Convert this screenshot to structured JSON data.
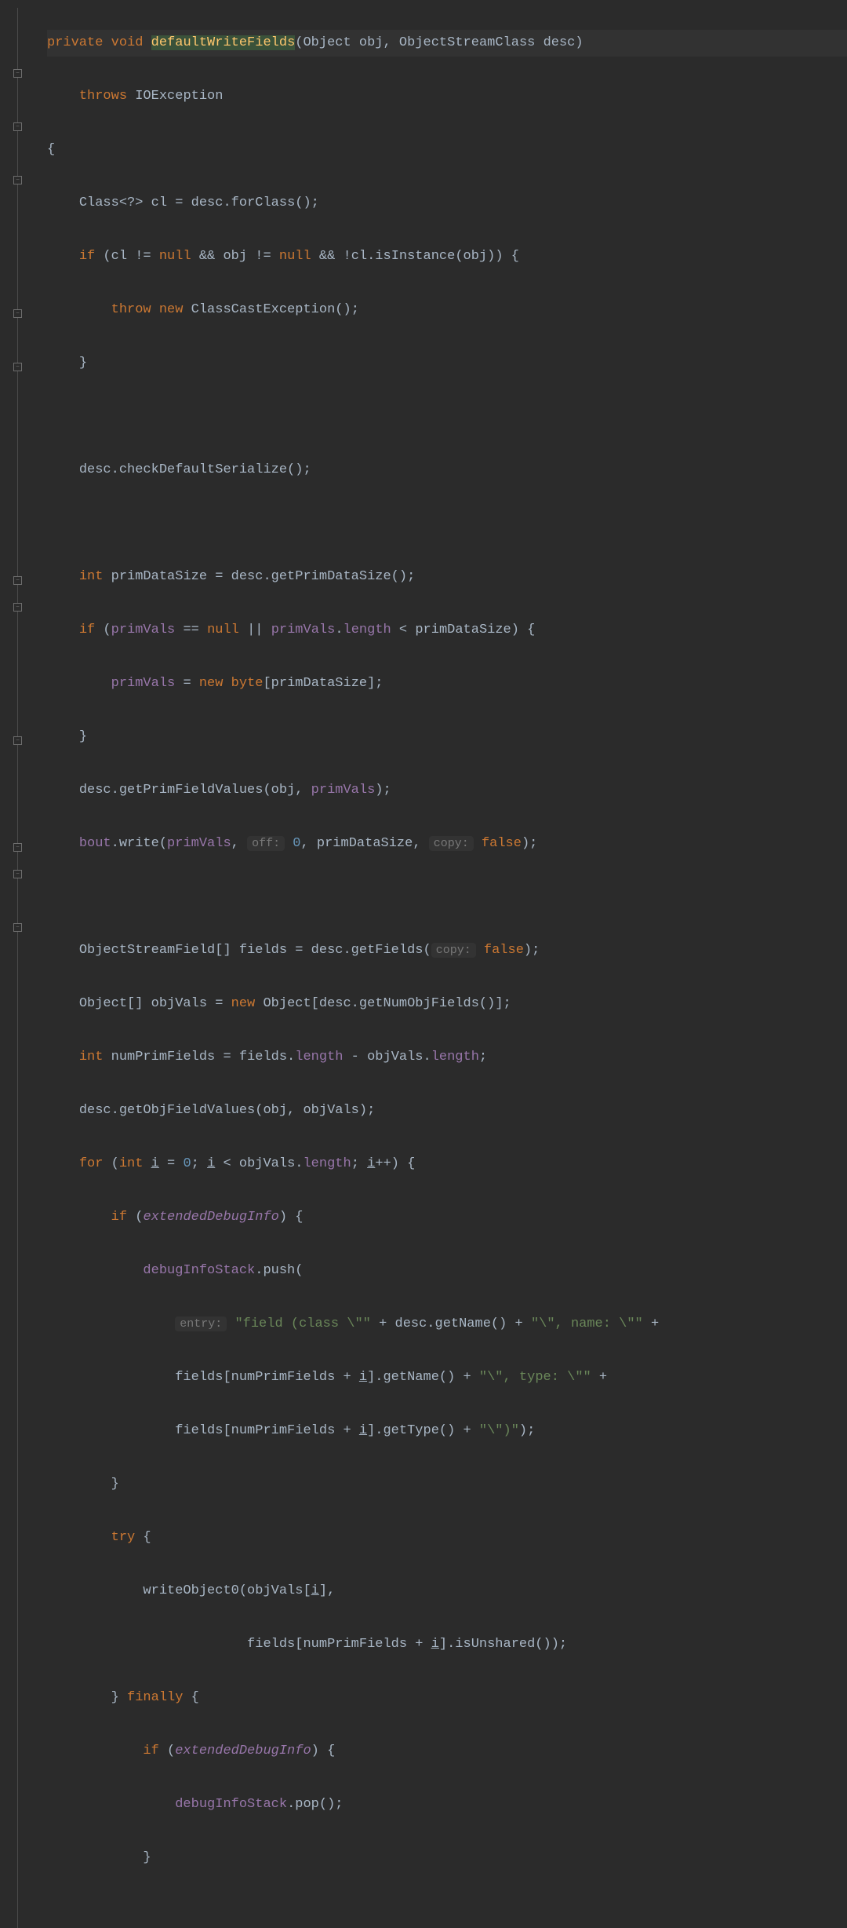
{
  "theme": {
    "background": "#2b2b2b",
    "foreground": "#a9b7c6",
    "keyword": "#cc7832",
    "methodDecl": "#ffc66d",
    "field": "#9876aa",
    "number": "#6897bb",
    "string": "#6a8759",
    "hint": "#787878"
  },
  "code": {
    "l1": {
      "kw1": "private",
      "kw2": "void",
      "method": "defaultWriteFields",
      "p1t": "Object",
      "p1n": "obj",
      "p2t": "ObjectStreamClass",
      "p2n": "desc"
    },
    "l2": {
      "kw": "throws",
      "ex": "IOException"
    },
    "l3": "{",
    "l4": {
      "t": "Class<?> ",
      "v": "cl",
      "eq": " = desc.forClass();"
    },
    "l5": {
      "kw": "if",
      "open": " (cl != ",
      "n1": "null",
      "amp": " && obj != ",
      "n2": "null",
      "amp2": " && !cl.isInstance(obj)) {"
    },
    "l6": {
      "kw1": "throw",
      "kw2": "new",
      "cls": " ClassCastException();"
    },
    "l7": "}",
    "l8": "desc.checkDefaultSerialize();",
    "l9": {
      "kw": "int",
      "rest": " primDataSize = desc.getPrimDataSize();"
    },
    "l10": {
      "kw": "if",
      "open": " (",
      "f1": "primVals",
      "eq": " == ",
      "n": "null",
      "or": " || ",
      "f2": "primVals",
      "dot": ".",
      "len": "length",
      "cmp": " < primDataSize) {"
    },
    "l11": {
      "f": "primVals",
      "eq": " = ",
      "kw": "new",
      "sp": " ",
      "kw2": "byte",
      "arr": "[primDataSize];"
    },
    "l12": "}",
    "l13": {
      "pre": "desc.getPrimFieldValues(obj, ",
      "f": "primVals",
      "post": ");"
    },
    "l14": {
      "f1": "bout",
      "call": ".write(",
      "f2": "primVals",
      "c": ", ",
      "h1": "off:",
      "sp1": " ",
      "n1": "0",
      "c2": ", primDataSize, ",
      "h2": "copy:",
      "sp2": " ",
      "kw": "false",
      "end": ");"
    },
    "l15": {
      "pre": "ObjectStreamField[] fields = desc.getFields(",
      "h": "copy:",
      "sp": " ",
      "kw": "false",
      "end": ");"
    },
    "l16": {
      "pre": "Object[] objVals = ",
      "kw": "new",
      "post": " Object[desc.getNumObjFields()];"
    },
    "l17": {
      "kw": "int",
      "pre": " numPrimFields = fields.",
      "f1": "length",
      "mid": " - objVals.",
      "f2": "length",
      "end": ";"
    },
    "l18": "desc.getObjFieldValues(obj, objVals);",
    "l19": {
      "kw1": "for",
      "open": " (",
      "kw2": "int",
      "sp": " ",
      "i1": "i",
      "eq": " = ",
      "n": "0",
      "sc": "; ",
      "i2": "i",
      "cmp": " < objVals.",
      "len": "length",
      "sc2": "; ",
      "i3": "i",
      "inc": "++) {"
    },
    "l20": {
      "kw": "if",
      "open": " (",
      "f": "extendedDebugInfo",
      "end": ") {"
    },
    "l21": {
      "f": "debugInfoStack",
      "call": ".push("
    },
    "l22": {
      "h": "entry:",
      "sp": " ",
      "s1": "\"field (class \\\"\"",
      "p1": " + desc.getName() + ",
      "s2": "\"\\\", name: \\\"\"",
      "p2": " +"
    },
    "l23": {
      "pre": "fields[numPrimFields + ",
      "i": "i",
      "mid": "].getName() + ",
      "s": "\"\\\", type: \\\"\"",
      "end": " +"
    },
    "l24": {
      "pre": "fields[numPrimFields + ",
      "i": "i",
      "mid": "].getType() + ",
      "s": "\"\\\")\"",
      "end": ");"
    },
    "l25": "}",
    "l26": {
      "kw": "try",
      "b": " {"
    },
    "l27": {
      "call": "writeObject0(objVals[",
      "i": "i",
      "end": "],"
    },
    "l28": {
      "pre": "fields[numPrimFields + ",
      "i": "i",
      "end": "].isUnshared());"
    },
    "l29": {
      "close": "} ",
      "kw": "finally",
      "open": " {"
    },
    "l30": {
      "kw": "if",
      "open": " (",
      "f": "extendedDebugInfo",
      "end": ") {"
    },
    "l31": {
      "f": "debugInfoStack",
      "call": ".pop();"
    },
    "l32": "}"
  }
}
